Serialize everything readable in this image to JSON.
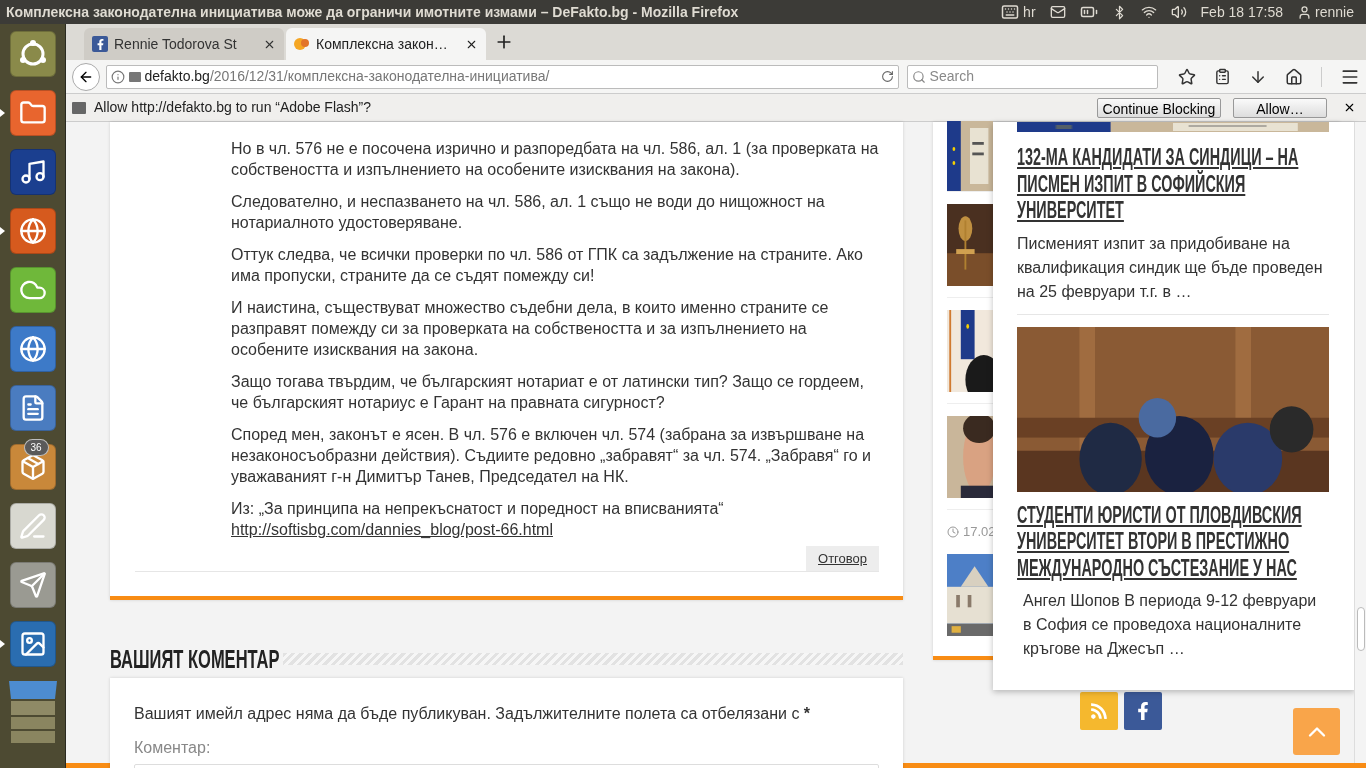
{
  "panel": {
    "title": "Комплексна законодателна инициатива може да ограничи имотните измами – DeFakto.bg - Mozilla Firefox",
    "keyboard": "hr",
    "datetime": "Feb 18 17:58",
    "user": "rennie"
  },
  "launcher": {
    "items": [
      {
        "kind": "ubuntu",
        "running": false
      },
      {
        "kind": "files",
        "running": true
      },
      {
        "kind": "audio",
        "running": false
      },
      {
        "kind": "browser",
        "running": true
      },
      {
        "kind": "cloud",
        "running": false
      },
      {
        "kind": "chromium",
        "running": false
      },
      {
        "kind": "pdf",
        "running": false
      },
      {
        "kind": "installer",
        "running": false,
        "badge": "36"
      },
      {
        "kind": "editor",
        "running": false
      },
      {
        "kind": "plane",
        "running": false
      },
      {
        "kind": "writer",
        "running": true
      }
    ]
  },
  "tabs": [
    {
      "label": "Rennie Todorova St",
      "selected": false,
      "kind": "facebook"
    },
    {
      "label": "Комплексна закон…",
      "selected": true,
      "kind": "site"
    }
  ],
  "address": {
    "domain": "defakto.bg",
    "path": "/2016/12/31/комплексна-законодателна-инициатива/"
  },
  "search": {
    "placeholder": "Search"
  },
  "notification": {
    "text": "Allow http://defakto.bg to run “Adobe Flash”?",
    "buttons": [
      "Continue Blocking",
      "Allow…"
    ]
  },
  "article": {
    "paragraphs": [
      "Но в чл. 576 не е посочена изрично и разпоредбата на чл. 586, ал. 1 (за проверката на собствеността и изпълнението на особените изисквания на закона).",
      "Следователно, и неспазването на чл. 586, ал. 1 също не води до нищожност на нотариалното удостоверяване.",
      "Оттук следва, че всички проверки по чл. 586 от ГПК са задължение на страните. Ако има пропуски, страните да се съдят помежду си!",
      "И наистина, съществуват множество съдебни дела, в които именно страните се разправят помежду си за проверката на собствеността и за изпълнението на особените изисквания на закона.",
      "Защо тогава твърдим, че българският нотариат е от латински тип? Защо се гордеем, че българският нотариус е Гарант на правната сигурност?",
      "Според мен, законът е ясен. В чл. 576 е включен чл. 574 (забрана за извършване на незаконосъобразни действия). Съдиите редовно „забравят“ за чл. 574. „Забравя“ го и уважаваният г-н Димитър Танев, Председател на НК."
    ],
    "source": "Из: „За принципа на непрекъснатост и поредност на вписванията“",
    "link": "http://softisbg.com/dannies_blog/post-66.html",
    "reply": "Отговор"
  },
  "comment_form": {
    "heading": "ВАШИЯТ КОМЕНТАР",
    "notice": "Вашият имейл адрес няма да бъде публикуван. Задължителните полета са отбелязани с",
    "required_mark": "*",
    "label": "Коментар:"
  },
  "sidebar": {
    "date": "17.02",
    "posts": [
      {
        "title": "132-МА КАНДИДАТИ ЗА СИНДИЦИ – НА ПИСМЕН ИЗПИТ В СОФИЙСКИЯ УНИВЕРСИТЕТ",
        "excerpt": "Писменият изпит за придобиване на квалификация синдик ще бъде проведен на 25 февруари т.г. в …"
      },
      {
        "title": "СТУДЕНТИ ЮРИСТИ ОТ ПЛОВДИВСКИЯ УНИВЕРСИТЕТ ВТОРИ В ПРЕСТИЖНО МЕЖДУНАРОДНО СЪСТЕЗАНИЕ У НАС",
        "excerpt": "Ангел Шопов В периода 9-12 февруари в София се проведоха националните кръгове на Джесъп …"
      }
    ]
  }
}
